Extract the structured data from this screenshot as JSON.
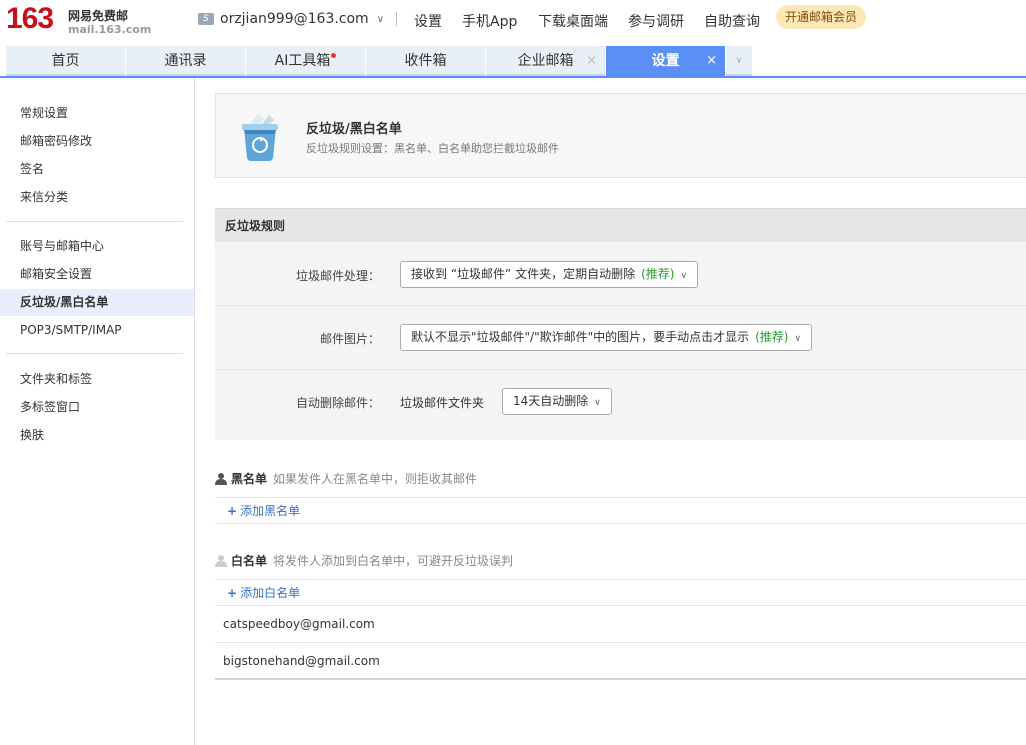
{
  "brand": {
    "number": "163",
    "name": "网易免费邮",
    "domain": "mail.163.com"
  },
  "account": {
    "email": "orzjian999@163.com"
  },
  "topnav": [
    "设置",
    "手机App",
    "下载桌面端",
    "参与调研",
    "自助查询"
  ],
  "vip_button": "开通邮箱会员",
  "tabs": [
    {
      "label": "首页"
    },
    {
      "label": "通讯录"
    },
    {
      "label": "AI工具箱"
    },
    {
      "label": "收件箱"
    },
    {
      "label": "企业邮箱"
    },
    {
      "label": "设置"
    }
  ],
  "sidebar": {
    "group1": [
      "常规设置",
      "邮箱密码修改",
      "签名",
      "来信分类"
    ],
    "group2": [
      "账号与邮箱中心",
      "邮箱安全设置",
      "反垃圾/黑白名单",
      "POP3/SMTP/IMAP"
    ],
    "group3": [
      "文件夹和标签",
      "多标签窗口",
      "换肤"
    ]
  },
  "header": {
    "title": "反垃圾/黑白名单",
    "subtitle": "反垃圾规则设置：黑名单、白名单助您拦截垃圾邮件"
  },
  "rules": {
    "section_title": "反垃圾规则",
    "spam_label": "垃圾邮件处理：",
    "spam_value": "接收到 “垃圾邮件” 文件夹，定期自动删除",
    "recommend": "(推荐)",
    "image_label": "邮件图片：",
    "image_value": "默认不显示\"垃圾邮件\"/\"欺诈邮件\"中的图片，要手动点击才显示",
    "autodel_label": "自动删除邮件：",
    "autodel_folder": "垃圾邮件文件夹",
    "autodel_value": "14天自动删除"
  },
  "blacklist": {
    "title": "黑名单",
    "desc": "如果发件人在黑名单中，则拒收其邮件",
    "add": "添加黑名单"
  },
  "whitelist": {
    "title": "白名单",
    "desc": "将发件人添加到白名单中，可避开反垃圾误判",
    "add": "添加白名单",
    "entries": [
      "catspeedboy@gmail.com",
      "bigstonehand@gmail.com"
    ]
  }
}
